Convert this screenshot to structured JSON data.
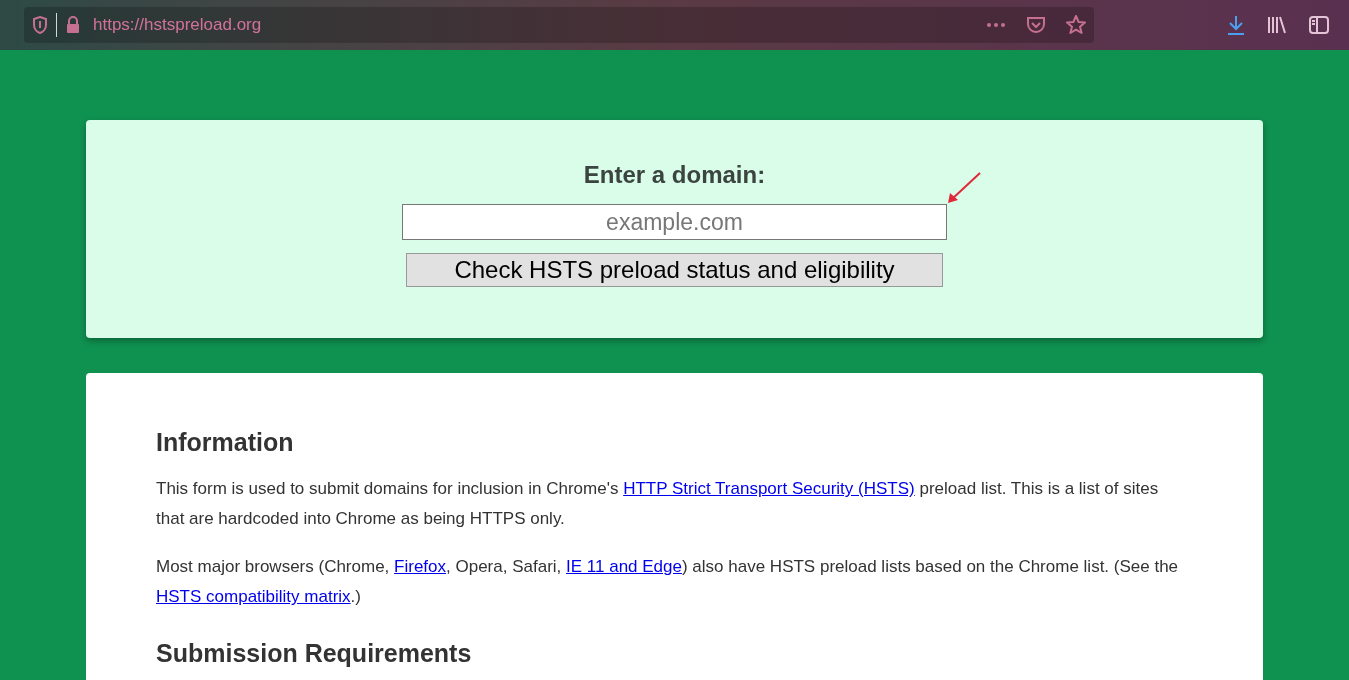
{
  "browser": {
    "url": "https://hstspreload.org"
  },
  "form": {
    "title": "Enter a domain:",
    "placeholder": "example.com",
    "button": "Check HSTS preload status and eligibility"
  },
  "info": {
    "heading": "Information",
    "paragraphs": [
      [
        {
          "kind": "text",
          "text": "This form is used to submit domains for inclusion in Chrome's "
        },
        {
          "kind": "link",
          "text": "HTTP Strict Transport Security (HSTS)"
        },
        {
          "kind": "text",
          "text": " preload list. This is a list of sites that are hardcoded into Chrome as being HTTPS only."
        }
      ],
      [
        {
          "kind": "text",
          "text": "Most major browsers (Chrome, "
        },
        {
          "kind": "link",
          "text": "Firefox"
        },
        {
          "kind": "text",
          "text": ", Opera, Safari, "
        },
        {
          "kind": "link",
          "text": "IE 11 and Edge"
        },
        {
          "kind": "text",
          "text": ") also have HSTS preload lists based on the Chrome list. (See the "
        },
        {
          "kind": "link",
          "text": "HSTS compatibility matrix"
        },
        {
          "kind": "text",
          "text": ".)"
        }
      ]
    ],
    "heading_2": "Submission Requirements"
  }
}
